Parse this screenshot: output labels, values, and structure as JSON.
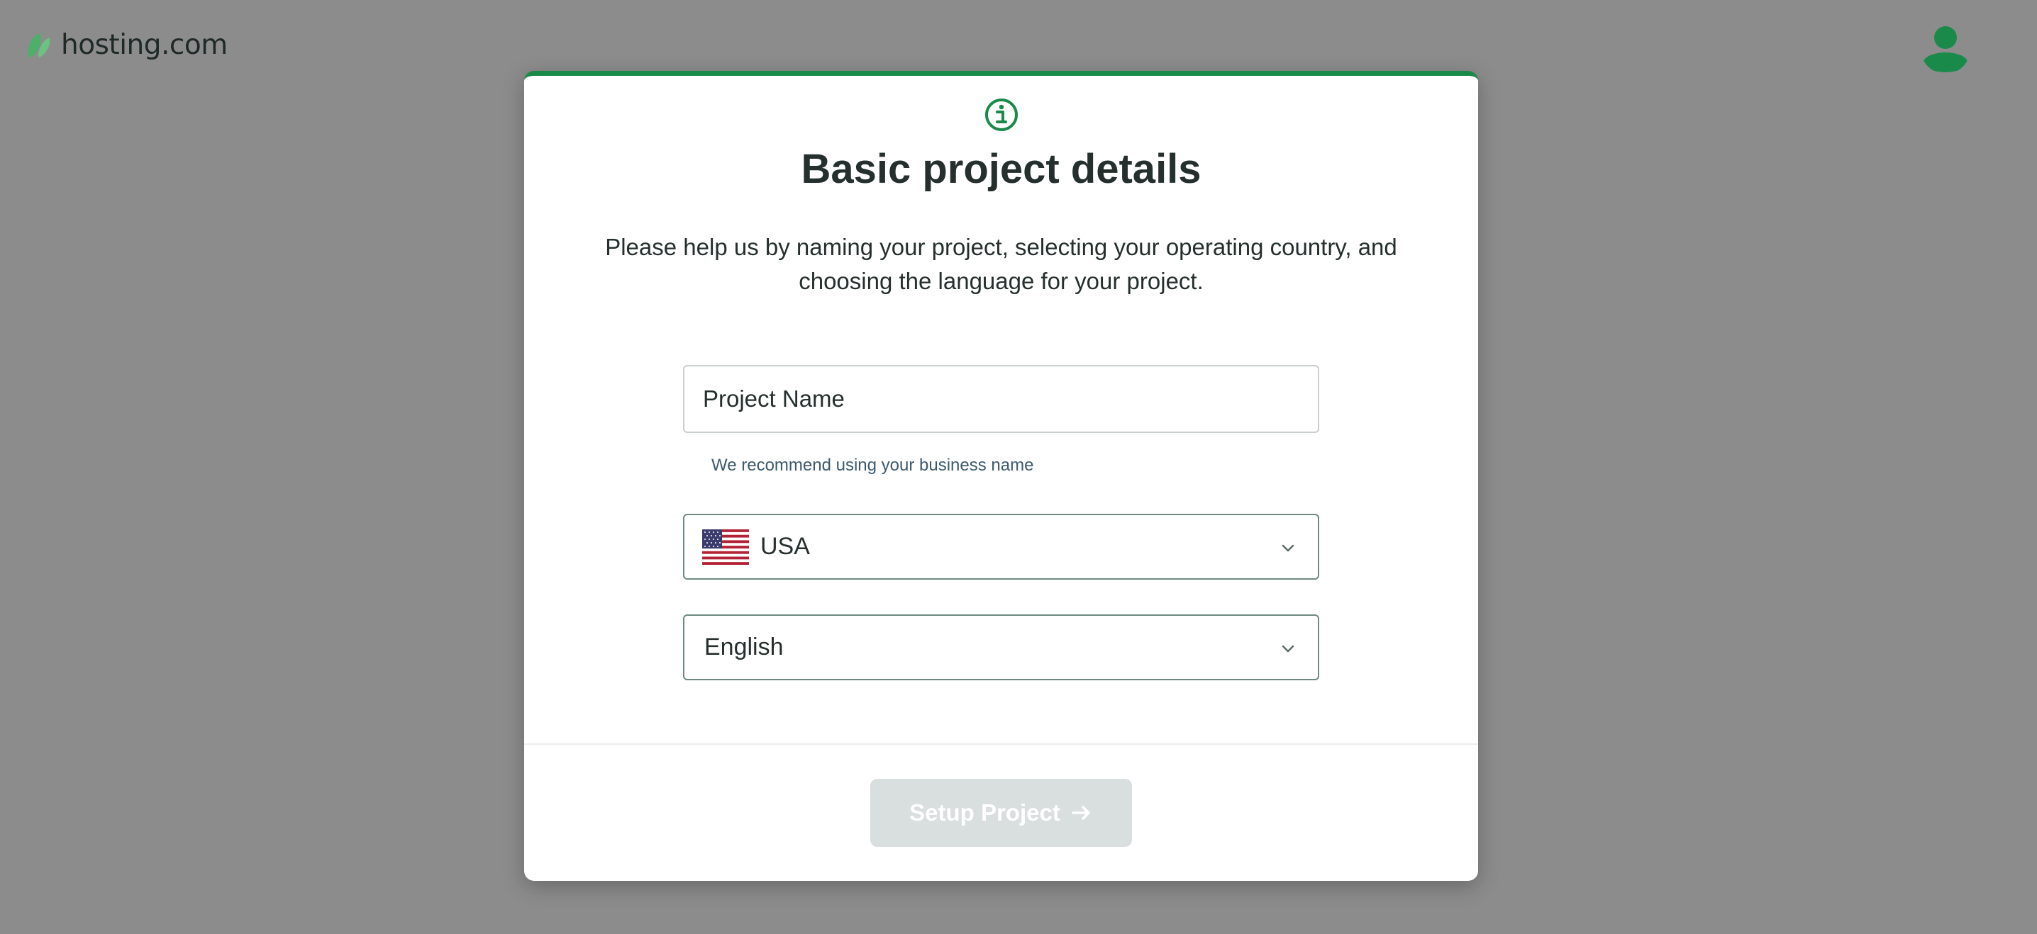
{
  "header": {
    "logo_text": "hosting.com",
    "logo_icon": "leaf-logo-icon",
    "avatar_icon": "user-avatar-icon"
  },
  "modal": {
    "icon": "info-icon",
    "title": "Basic project details",
    "subtitle": "Please help us by naming your project, selecting your operating country, and choosing the language for your project.",
    "project_name": {
      "placeholder": "Project Name",
      "value": "",
      "helper": "We recommend using your business name"
    },
    "country_select": {
      "selected": "USA",
      "flag_icon": "usa-flag-icon",
      "dropdown_icon": "chevron-down-icon"
    },
    "language_select": {
      "selected": "English",
      "dropdown_icon": "chevron-down-icon"
    },
    "setup_button": {
      "label": "Setup Project",
      "icon": "arrow-right-icon",
      "disabled": true
    }
  },
  "colors": {
    "accent": "#1a8a4a",
    "overlay": "#8c8c8c",
    "text": "#25302e",
    "button_disabled": "#d9dede",
    "helper_text": "#3d5a6e"
  }
}
